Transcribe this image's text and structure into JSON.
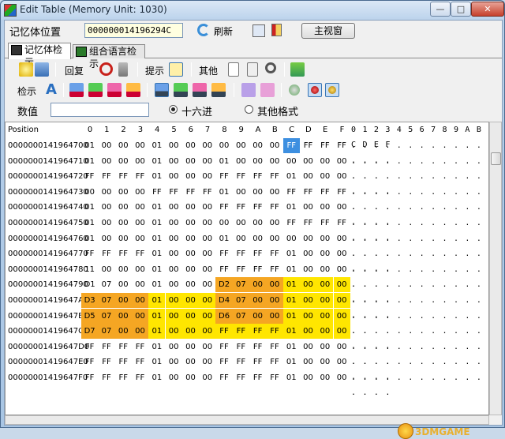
{
  "window": {
    "title": "Edit Table (Memory Unit: 1030)",
    "min_label": "—",
    "max_label": "□",
    "close_label": "✕"
  },
  "address_row": {
    "label": "记忆体位置",
    "address_value": "000000014196294C",
    "refresh_label": "刷新",
    "main_view_label": "主视窗"
  },
  "tabs": [
    {
      "label": "记忆体检示",
      "active": true
    },
    {
      "label": "组合语言检示",
      "active": false
    }
  ],
  "toolbar1": {
    "restore_label": "回复",
    "hint_label": "提示",
    "other_label": "其他"
  },
  "toolbar2": {
    "search_label": "检示"
  },
  "value_row": {
    "label": "数值",
    "value": "",
    "radio_hex_label": "十六进",
    "radio_other_label": "其他格式",
    "selected": "hex"
  },
  "grid": {
    "position_header": "Position",
    "byte_headers": [
      "0",
      "1",
      "2",
      "3",
      "4",
      "5",
      "6",
      "7",
      "8",
      "9",
      "A",
      "B",
      "C",
      "D",
      "E",
      "F"
    ],
    "ascii_header": "0 1 2 3 4 5 6 7 8 9 A B C D E F",
    "ascii_row": ". . . . . . . . . . . . . . . .",
    "rows": [
      {
        "addr": "0000000141964700",
        "bytes": [
          "01",
          "00",
          "00",
          "00",
          "01",
          "00",
          "00",
          "00",
          "00",
          "00",
          "00",
          "00",
          "FF",
          "FF",
          "FF",
          "FF"
        ],
        "hl": [
          "",
          "",
          "",
          "",
          "",
          "",
          "",
          "",
          "",
          "",
          "",
          "",
          "sel",
          "",
          "",
          ""
        ]
      },
      {
        "addr": "0000000141964710",
        "bytes": [
          "01",
          "00",
          "00",
          "00",
          "01",
          "00",
          "00",
          "00",
          "01",
          "00",
          "00",
          "00",
          "00",
          "00",
          "00",
          "00"
        ],
        "hl": [
          "",
          "",
          "",
          "",
          "",
          "",
          "",
          "",
          "",
          "",
          "",
          "",
          "",
          "",
          "",
          ""
        ]
      },
      {
        "addr": "0000000141964720",
        "bytes": [
          "FF",
          "FF",
          "FF",
          "FF",
          "01",
          "00",
          "00",
          "00",
          "FF",
          "FF",
          "FF",
          "FF",
          "01",
          "00",
          "00",
          "00"
        ],
        "hl": [
          "",
          "",
          "",
          "",
          "",
          "",
          "",
          "",
          "",
          "",
          "",
          "",
          "",
          "",
          "",
          ""
        ]
      },
      {
        "addr": "0000000141964730",
        "bytes": [
          "00",
          "00",
          "00",
          "00",
          "FF",
          "FF",
          "FF",
          "FF",
          "01",
          "00",
          "00",
          "00",
          "FF",
          "FF",
          "FF",
          "FF"
        ],
        "hl": [
          "",
          "",
          "",
          "",
          "",
          "",
          "",
          "",
          "",
          "",
          "",
          "",
          "",
          "",
          "",
          ""
        ]
      },
      {
        "addr": "0000000141964740",
        "bytes": [
          "01",
          "00",
          "00",
          "00",
          "01",
          "00",
          "00",
          "00",
          "FF",
          "FF",
          "FF",
          "FF",
          "01",
          "00",
          "00",
          "00"
        ],
        "hl": [
          "",
          "",
          "",
          "",
          "",
          "",
          "",
          "",
          "",
          "",
          "",
          "",
          "",
          "",
          "",
          ""
        ]
      },
      {
        "addr": "0000000141964750",
        "bytes": [
          "01",
          "00",
          "00",
          "00",
          "01",
          "00",
          "00",
          "00",
          "00",
          "00",
          "00",
          "00",
          "FF",
          "FF",
          "FF",
          "FF"
        ],
        "hl": [
          "",
          "",
          "",
          "",
          "",
          "",
          "",
          "",
          "",
          "",
          "",
          "",
          "",
          "",
          "",
          ""
        ]
      },
      {
        "addr": "0000000141964760",
        "bytes": [
          "01",
          "00",
          "00",
          "00",
          "01",
          "00",
          "00",
          "00",
          "01",
          "00",
          "00",
          "00",
          "00",
          "00",
          "00",
          "00"
        ],
        "hl": [
          "",
          "",
          "",
          "",
          "",
          "",
          "",
          "",
          "",
          "",
          "",
          "",
          "",
          "",
          "",
          ""
        ]
      },
      {
        "addr": "0000000141964770",
        "bytes": [
          "FF",
          "FF",
          "FF",
          "FF",
          "01",
          "00",
          "00",
          "00",
          "FF",
          "FF",
          "FF",
          "FF",
          "01",
          "00",
          "00",
          "00"
        ],
        "hl": [
          "",
          "",
          "",
          "",
          "",
          "",
          "",
          "",
          "",
          "",
          "",
          "",
          "",
          "",
          "",
          ""
        ]
      },
      {
        "addr": "0000000141964780",
        "bytes": [
          "11",
          "00",
          "00",
          "00",
          "01",
          "00",
          "00",
          "00",
          "FF",
          "FF",
          "FF",
          "FF",
          "01",
          "00",
          "00",
          "00"
        ],
        "hl": [
          "",
          "",
          "",
          "",
          "",
          "",
          "",
          "",
          "",
          "",
          "",
          "",
          "",
          "",
          "",
          ""
        ]
      },
      {
        "addr": "0000000141964790",
        "bytes": [
          "D1",
          "07",
          "00",
          "00",
          "01",
          "00",
          "00",
          "00",
          "D2",
          "07",
          "00",
          "00",
          "01",
          "00",
          "00",
          "00"
        ],
        "hl": [
          "",
          "",
          "",
          "",
          "",
          "",
          "",
          "",
          "o",
          "o",
          "o",
          "o",
          "y",
          "y",
          "y",
          "y"
        ]
      },
      {
        "addr": "00000001419647A0",
        "bytes": [
          "D3",
          "07",
          "00",
          "00",
          "01",
          "00",
          "00",
          "00",
          "D4",
          "07",
          "00",
          "00",
          "01",
          "00",
          "00",
          "00"
        ],
        "hl": [
          "o",
          "o",
          "o",
          "o",
          "y",
          "y",
          "y",
          "y",
          "o",
          "o",
          "o",
          "o",
          "y",
          "y",
          "y",
          "y"
        ]
      },
      {
        "addr": "00000001419647B0",
        "bytes": [
          "D5",
          "07",
          "00",
          "00",
          "01",
          "00",
          "00",
          "00",
          "D6",
          "07",
          "00",
          "00",
          "01",
          "00",
          "00",
          "00"
        ],
        "hl": [
          "o",
          "o",
          "o",
          "o",
          "y",
          "y",
          "y",
          "y",
          "o",
          "o",
          "o",
          "o",
          "y",
          "y",
          "y",
          "y"
        ]
      },
      {
        "addr": "00000001419647C0",
        "bytes": [
          "D7",
          "07",
          "00",
          "00",
          "01",
          "00",
          "00",
          "00",
          "FF",
          "FF",
          "FF",
          "FF",
          "01",
          "00",
          "00",
          "00"
        ],
        "hl": [
          "o",
          "o",
          "o",
          "o",
          "y",
          "y",
          "y",
          "y",
          "y",
          "y",
          "y",
          "y",
          "y",
          "y",
          "y",
          "y"
        ]
      },
      {
        "addr": "00000001419647D0",
        "bytes": [
          "FF",
          "FF",
          "FF",
          "FF",
          "01",
          "00",
          "00",
          "00",
          "FF",
          "FF",
          "FF",
          "FF",
          "01",
          "00",
          "00",
          "00"
        ],
        "hl": [
          "",
          "",
          "",
          "",
          "",
          "",
          "",
          "",
          "",
          "",
          "",
          "",
          "",
          "",
          "",
          ""
        ]
      },
      {
        "addr": "00000001419647E0",
        "bytes": [
          "FF",
          "FF",
          "FF",
          "FF",
          "01",
          "00",
          "00",
          "00",
          "FF",
          "FF",
          "FF",
          "FF",
          "01",
          "00",
          "00",
          "00"
        ],
        "hl": [
          "",
          "",
          "",
          "",
          "",
          "",
          "",
          "",
          "",
          "",
          "",
          "",
          "",
          "",
          "",
          ""
        ]
      },
      {
        "addr": "00000001419647F0",
        "bytes": [
          "FF",
          "FF",
          "FF",
          "FF",
          "01",
          "00",
          "00",
          "00",
          "FF",
          "FF",
          "FF",
          "FF",
          "01",
          "00",
          "00",
          "00"
        ],
        "hl": [
          "",
          "",
          "",
          "",
          "",
          "",
          "",
          "",
          "",
          "",
          "",
          "",
          "",
          "",
          "",
          ""
        ]
      }
    ]
  },
  "colors": {
    "highlight_orange": "#f5a623",
    "highlight_yellow": "#ffe600",
    "selected_blue": "#3d8fe0"
  },
  "watermark": "3DMGAME"
}
